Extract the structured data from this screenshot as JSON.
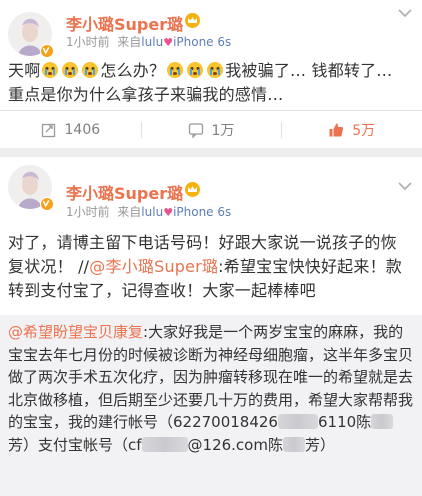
{
  "posts": [
    {
      "author": "李小璐Super璐",
      "time": "1小时前",
      "source_prefix": "来自",
      "source_name": "lulu",
      "source_device": "iPhone 6s",
      "text": {
        "p1": "天啊",
        "p2": "怎么办？",
        "p3": "我被骗了… 钱都转了… 重点是你为什么拿孩子来骗我的感情…"
      },
      "actions": {
        "repost": "1406",
        "comment": "1万",
        "like": "5万"
      }
    },
    {
      "author": "李小璐Super璐",
      "time": "1小时前",
      "source_prefix": "来自",
      "source_name": "lulu",
      "source_device": "iPhone 6s",
      "text": {
        "p1": "对了，请博主留下电话号码！好跟大家说一说孩子的恢复状况！ //",
        "mention": "@李小璐Super璐",
        "p2": ":希望宝宝快快好起来！款转到支付宝了，记得查收！大家一起棒棒吧"
      },
      "repost": {
        "mention": "@希望盼望宝贝康复",
        "p1": ":大家好我是一个两岁宝宝的麻麻，我的宝宝去年七月份的时候被诊断为神经母细胞瘤，这半年多宝贝做了两次手术五次化疗，因为肿瘤转移现在唯一的希望就是去北京做移植，但后期至少还要几十万的费用，希望大家帮帮我的宝宝，我的建行帐号（62270018426",
        "p2": "6110陈",
        "p3": "芳）支付宝帐号（cf",
        "p4": "@126.com陈",
        "p5": "芳）"
      }
    }
  ],
  "icons": {
    "emoji": "crying-face-icon",
    "repost": "repost-icon",
    "comment": "comment-icon",
    "like": "thumbs-up-icon",
    "more": "chevron-down-icon",
    "verified": "verified-badge-icon",
    "member": "crown-icon"
  },
  "colors": {
    "accent": "#eb7350",
    "link": "#5d7fb6",
    "badge": "#f7a11a"
  }
}
